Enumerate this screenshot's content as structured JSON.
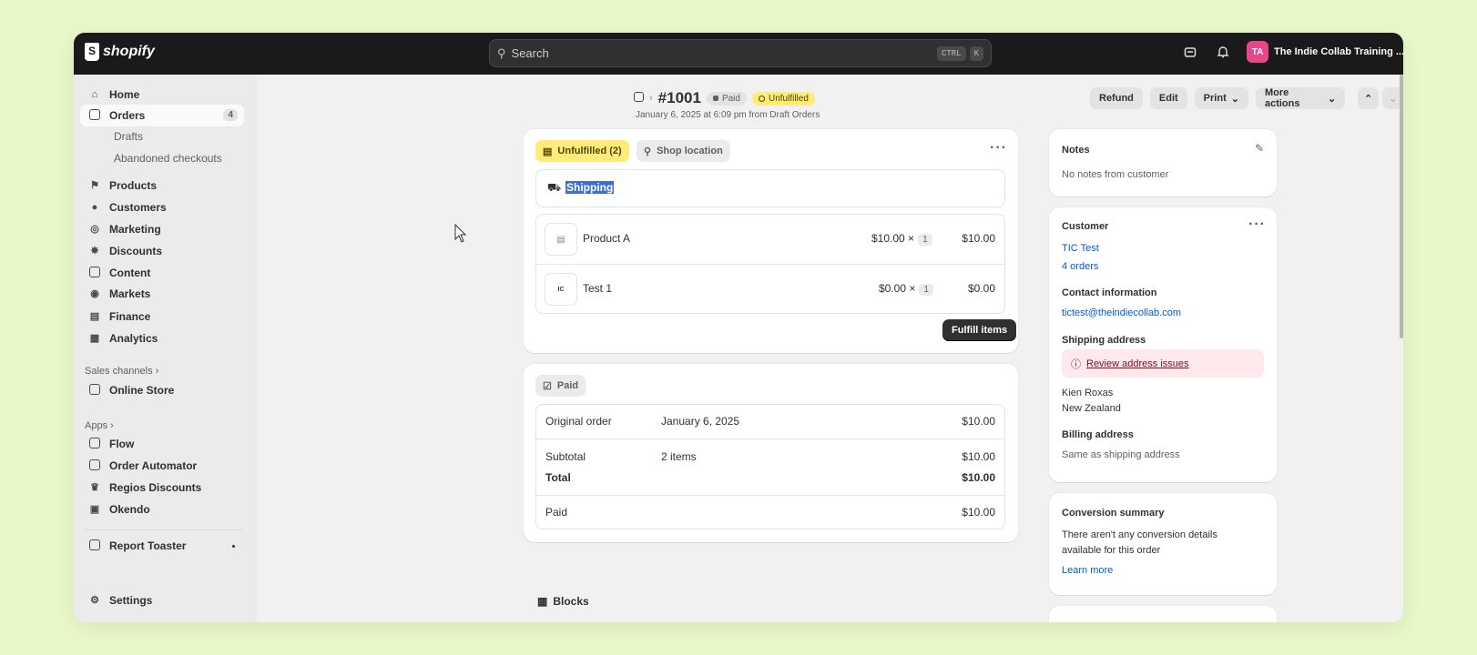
{
  "topbar": {
    "logo": "shopify",
    "search_placeholder": "Search",
    "shortcut_ctrl": "CTRL",
    "shortcut_k": "K",
    "avatar_initials": "TA",
    "store_name": "The Indie Collab Training ...",
    "icons": [
      "search-icon",
      "store-icon",
      "bell-icon"
    ]
  },
  "sidebar": {
    "items": [
      {
        "label": "Home",
        "icon": "home-icon"
      },
      {
        "label": "Orders",
        "icon": "inbox-icon",
        "badge": "4"
      },
      {
        "label": "Drafts"
      },
      {
        "label": "Abandoned checkouts"
      },
      {
        "label": "Products",
        "icon": "tag-icon"
      },
      {
        "label": "Customers",
        "icon": "person-icon"
      },
      {
        "label": "Marketing",
        "icon": "target-icon"
      },
      {
        "label": "Discounts",
        "icon": "discount-icon"
      },
      {
        "label": "Content",
        "icon": "content-icon"
      },
      {
        "label": "Markets",
        "icon": "globe-icon"
      },
      {
        "label": "Finance",
        "icon": "bank-icon"
      },
      {
        "label": "Analytics",
        "icon": "chart-icon"
      }
    ],
    "sales_channels_title": "Sales channels",
    "sales_channels": [
      {
        "label": "Online Store"
      }
    ],
    "apps_title": "Apps",
    "apps": [
      {
        "label": "Flow"
      },
      {
        "label": "Order Automator"
      },
      {
        "label": "Regios Discounts"
      },
      {
        "label": "Okendo"
      }
    ],
    "pinned": [
      {
        "label": "Report Toaster"
      }
    ],
    "settings": "Settings"
  },
  "order": {
    "number": "#1001",
    "paid_badge": "Paid",
    "unfulfilled_badge": "Unfulfilled",
    "subline": "January 6, 2025 at 6:09 pm from Draft Orders",
    "actions": {
      "refund": "Refund",
      "edit": "Edit",
      "print": "Print",
      "more": "More actions"
    }
  },
  "fulfillment": {
    "status": "Unfulfilled (2)",
    "location": "Shop location",
    "method": "Shipping",
    "items": [
      {
        "name": "Product A",
        "price": "$10.00",
        "times": "×",
        "qty": "1",
        "total": "$10.00"
      },
      {
        "name": "Test 1",
        "price": "$0.00",
        "times": "×",
        "qty": "1",
        "total": "$0.00"
      }
    ],
    "fulfill_button": "Fulfill items"
  },
  "payment": {
    "status": "Paid",
    "original_order_label": "Original order",
    "original_order_date": "January 6, 2025",
    "original_order_amount": "$10.00",
    "subtotal_label": "Subtotal",
    "subtotal_items": "2 items",
    "subtotal_amount": "$10.00",
    "total_label": "Total",
    "total_amount": "$10.00",
    "paid_label": "Paid",
    "paid_amount": "$10.00"
  },
  "blocks_title": "Blocks",
  "notes": {
    "title": "Notes",
    "text": "No notes from customer"
  },
  "customer": {
    "title": "Customer",
    "name": "TIC Test",
    "orders": "4 orders",
    "contact_title": "Contact information",
    "email": "tictest@theindiecollab.com",
    "shipping_title": "Shipping address",
    "warning": "Review address issues",
    "address_line1": "Kien Roxas",
    "address_line2": "New Zealand",
    "billing_title": "Billing address",
    "billing_text": "Same as shipping address"
  },
  "conversion": {
    "title": "Conversion summary",
    "text_line1": "There aren't any conversion details",
    "text_line2": "available for this order",
    "link": "Learn more"
  },
  "colors": {
    "topbar": "#1a1a1a",
    "badge_yellow": "#ffeb78",
    "link_blue": "#005bd3",
    "avatar_pink": "#e8458b",
    "warning_bg": "#fee9ec"
  }
}
